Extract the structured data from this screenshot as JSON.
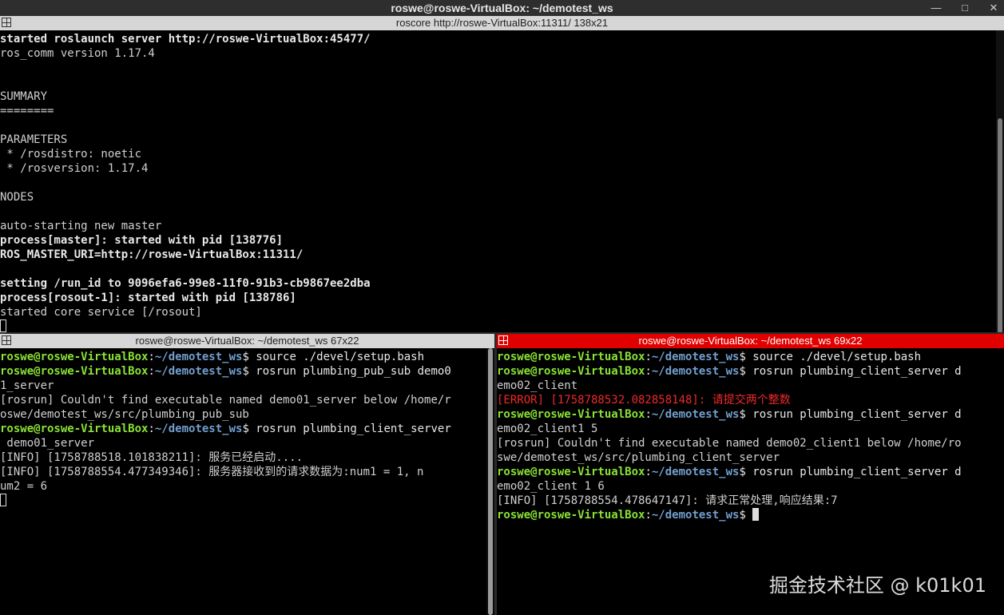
{
  "window": {
    "title": "roswe@roswe-VirtualBox: ~/demotest_ws",
    "buttons": [
      "—",
      "□",
      "✕"
    ]
  },
  "top_pane": {
    "title": "roscore http://roswe-VirtualBox:11311/ 138x21",
    "lines": [
      {
        "t": "started roslaunch server http://roswe-VirtualBox:45477/",
        "s": "b"
      },
      {
        "t": "ros_comm version 1.17.4",
        "s": ""
      },
      {
        "t": "",
        "s": ""
      },
      {
        "t": "",
        "s": ""
      },
      {
        "t": "SUMMARY",
        "s": ""
      },
      {
        "t": "========",
        "s": ""
      },
      {
        "t": "",
        "s": ""
      },
      {
        "t": "PARAMETERS",
        "s": ""
      },
      {
        "t": " * /rosdistro: noetic",
        "s": ""
      },
      {
        "t": " * /rosversion: 1.17.4",
        "s": ""
      },
      {
        "t": "",
        "s": ""
      },
      {
        "t": "NODES",
        "s": ""
      },
      {
        "t": "",
        "s": ""
      },
      {
        "t": "auto-starting new master",
        "s": ""
      },
      {
        "t": "process[master]: started with pid [138776]",
        "s": "b"
      },
      {
        "t": "ROS_MASTER_URI=http://roswe-VirtualBox:11311/",
        "s": "b"
      },
      {
        "t": "",
        "s": ""
      },
      {
        "t": "setting /run_id to 9096efa6-99e8-11f0-91b3-cb9867ee2dba",
        "s": "b"
      },
      {
        "t": "process[rosout-1]: started with pid [138786]",
        "s": "b"
      },
      {
        "t": "started core service [/rosout]",
        "s": ""
      }
    ]
  },
  "left_pane": {
    "title": "roswe@roswe-VirtualBox: ~/demotest_ws 67x22",
    "lines": [
      {
        "prompt": true,
        "user": "roswe@roswe-VirtualBox",
        "path": "~/demotest_ws",
        "cmd": "$ source ./devel/setup.bash"
      },
      {
        "prompt": true,
        "user": "roswe@roswe-VirtualBox",
        "path": "~/demotest_ws",
        "cmd": "$ rosrun plumbing_pub_sub demo0"
      },
      {
        "t": "1_server"
      },
      {
        "t": "[rosrun] Couldn't find executable named demo01_server below /home/r"
      },
      {
        "t": "oswe/demotest_ws/src/plumbing_pub_sub"
      },
      {
        "prompt": true,
        "user": "roswe@roswe-VirtualBox",
        "path": "~/demotest_ws",
        "cmd": "$ rosrun plumbing_client_server"
      },
      {
        "t": " demo01_server"
      },
      {
        "t": "[INFO] [1758788518.101838211]: 服务已经启动...."
      },
      {
        "t": "[INFO] [1758788554.477349346]: 服务器接收到的请求数据为:num1 = 1, n"
      },
      {
        "t": "um2 = 6"
      }
    ]
  },
  "right_pane": {
    "title": "roswe@roswe-VirtualBox: ~/demotest_ws 69x22",
    "lines": [
      {
        "prompt": true,
        "user": "roswe@roswe-VirtualBox",
        "path": "~/demotest_ws",
        "cmd": "$ source ./devel/setup.bash"
      },
      {
        "prompt": true,
        "user": "roswe@roswe-VirtualBox",
        "path": "~/demotest_ws",
        "cmd": "$ rosrun plumbing_client_server d"
      },
      {
        "t": "emo02_client"
      },
      {
        "t": "[ERROR] [1758788532.082858148]: 请提交两个整数",
        "err": true
      },
      {
        "prompt": true,
        "user": "roswe@roswe-VirtualBox",
        "path": "~/demotest_ws",
        "cmd": "$ rosrun plumbing_client_server d"
      },
      {
        "t": "emo02_client1 5"
      },
      {
        "t": "[rosrun] Couldn't find executable named demo02_client1 below /home/ro"
      },
      {
        "t": "swe/demotest_ws/src/plumbing_client_server"
      },
      {
        "prompt": true,
        "user": "roswe@roswe-VirtualBox",
        "path": "~/demotest_ws",
        "cmd": "$ rosrun plumbing_client_server d"
      },
      {
        "t": "emo02_client 1 6"
      },
      {
        "t": "[INFO] [1758788554.478647147]: 请求正常处理,响应结果:7"
      },
      {
        "prompt": true,
        "user": "roswe@roswe-VirtualBox",
        "path": "~/demotest_ws",
        "cmd": "$ ",
        "cursor": true
      }
    ]
  },
  "watermark": "掘金技术社区 @ k01k01",
  "colors": {
    "prompt_user": "#8ae234",
    "prompt_path": "#729fcf",
    "error": "#ef2929",
    "active_header": "#e00000"
  }
}
